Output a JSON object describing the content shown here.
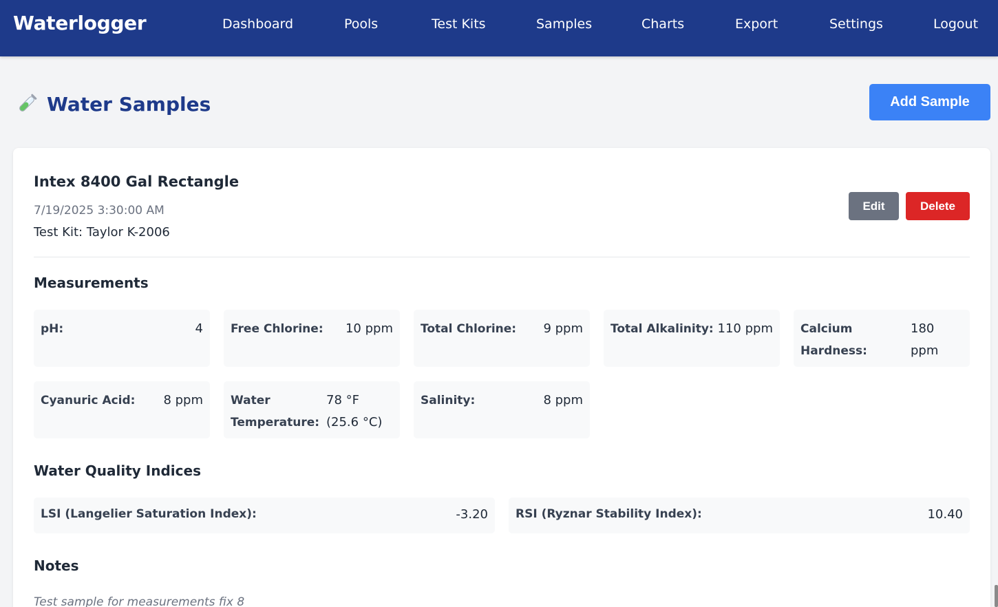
{
  "app": {
    "brand": "Waterlogger"
  },
  "nav": {
    "items": [
      {
        "label": "Dashboard"
      },
      {
        "label": "Pools"
      },
      {
        "label": "Test Kits"
      },
      {
        "label": "Samples"
      },
      {
        "label": "Charts"
      },
      {
        "label": "Export"
      },
      {
        "label": "Settings"
      },
      {
        "label": "Logout"
      }
    ]
  },
  "page": {
    "title": "Water Samples",
    "title_icon": "test-tube-icon",
    "add_button_label": "Add Sample"
  },
  "sample": {
    "pool_name": "Intex 8400 Gal Rectangle",
    "date": "7/19/2025 3:30:00 AM",
    "test_kit": "Test Kit: Taylor K-2006",
    "edit_label": "Edit",
    "delete_label": "Delete",
    "measurements_heading": "Measurements",
    "measurements": [
      {
        "label": "pH:",
        "value": "4"
      },
      {
        "label": "Free Chlorine:",
        "value": "10 ppm"
      },
      {
        "label": "Total Chlorine:",
        "value": "9 ppm"
      },
      {
        "label": "Total Alkalinity:",
        "value": "110 ppm"
      },
      {
        "label": "Calcium Hardness:",
        "value": "180 ppm"
      },
      {
        "label": "Cyanuric Acid:",
        "value": "8 ppm"
      },
      {
        "label": "Water Temperature:",
        "value": "78 °F (25.6 °C)"
      },
      {
        "label": "Salinity:",
        "value": "8 ppm"
      }
    ],
    "indices_heading": "Water Quality Indices",
    "indices": [
      {
        "label": "LSI (Langelier Saturation Index):",
        "value": "-3.20"
      },
      {
        "label": "RSI (Ryznar Stability Index):",
        "value": "10.40"
      }
    ],
    "notes_heading": "Notes",
    "notes": "Test sample for measurements fix 8"
  },
  "colors": {
    "navbar": "#1e3a8a",
    "title": "#1e3a8a",
    "primary": "#3b82f6",
    "edit": "#6b7280",
    "delete": "#dc2626"
  }
}
